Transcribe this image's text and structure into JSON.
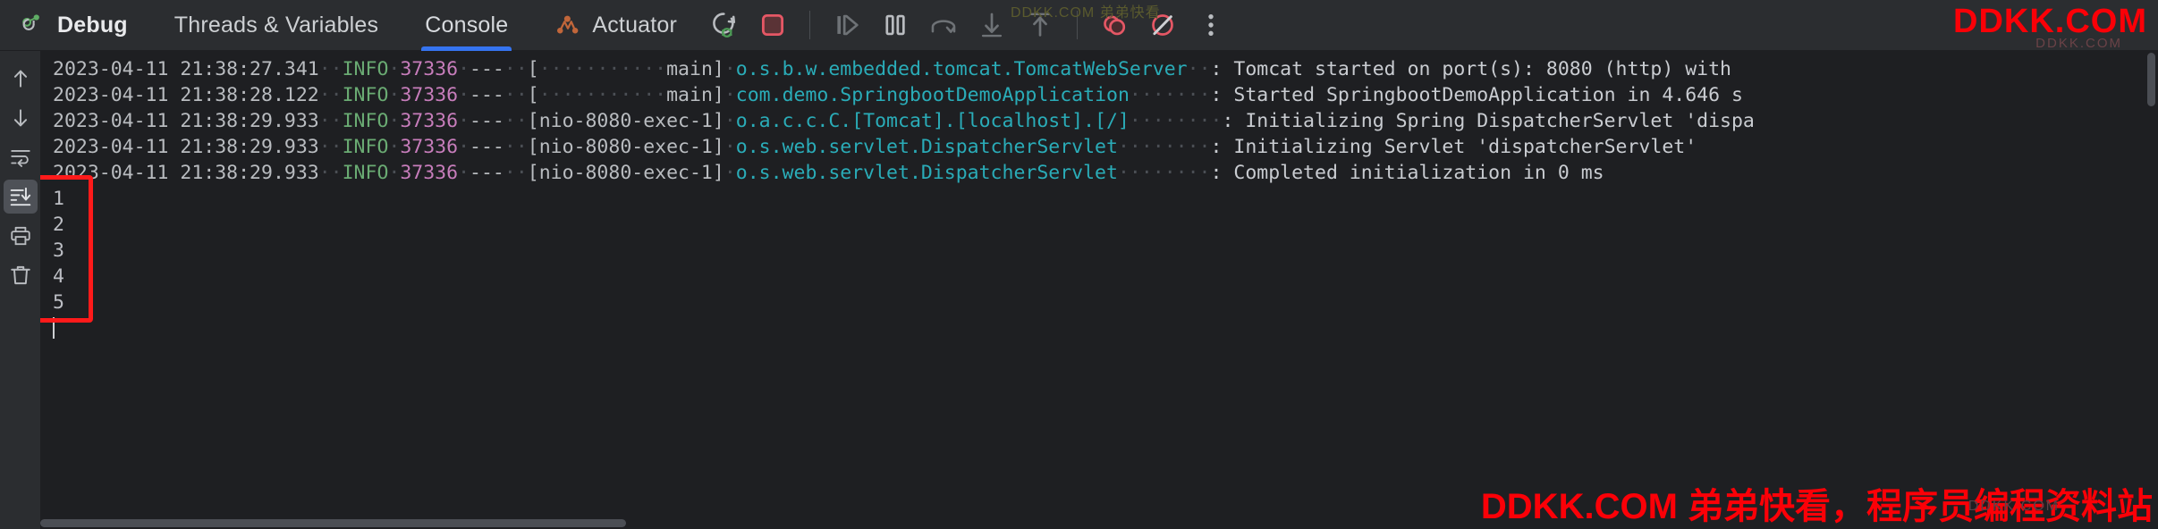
{
  "toolbar": {
    "debug_label": "Debug",
    "threads_label": "Threads & Variables",
    "console_label": "Console",
    "actuator_label": "Actuator",
    "buttons": [
      {
        "name": "rerun-debug",
        "label": "Rerun Debug"
      },
      {
        "name": "stop",
        "label": "Stop"
      },
      {
        "name": "resume-program",
        "label": "Resume Program"
      },
      {
        "name": "pause-program",
        "label": "Pause Program"
      },
      {
        "name": "step-over",
        "label": "Step Over"
      },
      {
        "name": "step-into",
        "label": "Step Into"
      },
      {
        "name": "step-out",
        "label": "Step Out"
      },
      {
        "name": "view-breakpoints",
        "label": "View Breakpoints"
      },
      {
        "name": "mute-breakpoints",
        "label": "Mute Breakpoints"
      },
      {
        "name": "more-options",
        "label": "More Options"
      }
    ]
  },
  "sidebar": {
    "items": [
      {
        "name": "up-arrow-icon",
        "label": "Previous Occurrence"
      },
      {
        "name": "down-arrow-icon",
        "label": "Next Occurrence"
      },
      {
        "name": "soft-wrap-icon",
        "label": "Soft-Wrap"
      },
      {
        "name": "scroll-to-end-icon",
        "label": "Scroll to End",
        "active": true
      },
      {
        "name": "print-icon",
        "label": "Print"
      },
      {
        "name": "trash-icon",
        "label": "Clear All"
      }
    ]
  },
  "console": {
    "lines": [
      {
        "time": "2023-04-11 21:38:27.341",
        "level": "INFO",
        "pid": "37336",
        "dash": "---",
        "thread": "[           main]",
        "logger": "o.s.b.w.embedded.tomcat.TomcatWebServer",
        "logger_pad": "  ",
        "message": ": Tomcat started on port(s): 8080 (http) with"
      },
      {
        "time": "2023-04-11 21:38:28.122",
        "level": "INFO",
        "pid": "37336",
        "dash": "---",
        "thread": "[           main]",
        "logger": "com.demo.SpringbootDemoApplication",
        "logger_pad": "       ",
        "message": ": Started SpringbootDemoApplication in 4.646 s"
      },
      {
        "time": "2023-04-11 21:38:29.933",
        "level": "INFO",
        "pid": "37336",
        "dash": "---",
        "thread": "[nio-8080-exec-1]",
        "logger": "o.a.c.c.C.[Tomcat].[localhost].[/]",
        "logger_pad": "        ",
        "message": ": Initializing Spring DispatcherServlet 'dispa"
      },
      {
        "time": "2023-04-11 21:38:29.933",
        "level": "INFO",
        "pid": "37336",
        "dash": "---",
        "thread": "[nio-8080-exec-1]",
        "logger": "o.s.web.servlet.DispatcherServlet",
        "logger_pad": "        ",
        "message": ": Initializing Servlet 'dispatcherServlet'"
      },
      {
        "time": "2023-04-11 21:38:29.933",
        "level": "INFO",
        "pid": "37336",
        "dash": "---",
        "thread": "[nio-8080-exec-1]",
        "logger": "o.s.web.servlet.DispatcherServlet",
        "logger_pad": "        ",
        "message": ": Completed initialization in 0 ms"
      }
    ],
    "output_numbers": [
      "1",
      "2",
      "3",
      "4",
      "5"
    ]
  },
  "annotation": {
    "box_color": "#ff1a1a"
  },
  "watermarks": {
    "top_right": "DDKK.COM",
    "top_right_faint": "DDKK.COM",
    "mid_faint": "DDKK.COM 弟弟快看",
    "bottom": "DDKK.COM 弟弟快看，程序员编程资料站",
    "bottom_faint": "DDKK.COM"
  },
  "colors": {
    "accent": "#3574f0",
    "level_info": "#6aab73",
    "pid": "#c77dbb",
    "logger": "#2aacb8",
    "stop": "#e55765",
    "actuator": "#c1663a",
    "annotation": "#ff1a1a",
    "watermark": "#fb0007"
  }
}
